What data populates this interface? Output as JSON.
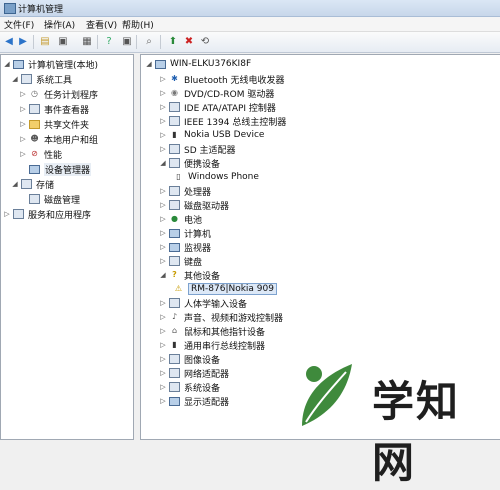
{
  "window": {
    "title": "计算机管理"
  },
  "menu": {
    "file": "文件(F)",
    "action": "操作(A)",
    "view": "查看(V)",
    "help": "帮助(H)"
  },
  "toolbar": {
    "icons": [
      "back-arrow",
      "forward-arrow",
      "up-folder",
      "show-hide-tree",
      "export",
      "properties",
      "help",
      "view",
      "scan-hardware",
      "update-driver",
      "disable-device",
      "uninstall"
    ]
  },
  "left": {
    "root": "计算机管理(本地)",
    "system_tools": "系统工具",
    "items": [
      "任务计划程序",
      "事件查看器",
      "共享文件夹",
      "本地用户和组",
      "性能",
      "设备管理器"
    ],
    "storage": "存储",
    "disk": "磁盘管理",
    "services": "服务和应用程序"
  },
  "right": {
    "computer": "WIN-ELKU376KI8F",
    "devices": [
      "Bluetooth 无线电收发器",
      "DVD/CD-ROM 驱动器",
      "IDE ATA/ATAPI 控制器",
      "IEEE 1394 总线主控制器",
      "Nokia USB Device",
      "SD 主适配器",
      "便携设备",
      "Windows Phone",
      "处理器",
      "磁盘驱动器",
      "电池",
      "计算机",
      "监视器",
      "键盘",
      "其他设备",
      "RM-876|Nokia 909",
      "人体学输入设备",
      "声音、视频和游戏控制器",
      "鼠标和其他指针设备",
      "通用串行总线控制器",
      "图像设备",
      "网络适配器",
      "系统设备",
      "显示适配器"
    ]
  },
  "watermark": {
    "text": "学知网"
  },
  "colors": {
    "selection": "#dce8f7",
    "watermark_leaf": "#3f8a3c"
  }
}
